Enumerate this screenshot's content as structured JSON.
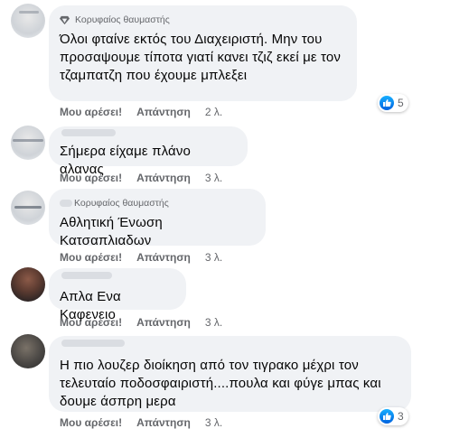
{
  "comments": [
    {
      "badge": "Κορυφαίος θαυμαστής",
      "lines": [
        "Όλοι φταίνε εκτός του Διαχειριστή. Μην του",
        "προσαψουμε τίποτα γιατί κανει τζιζ εκεί με τον",
        "τζαμπατζη που έχουμε μπλεξει"
      ],
      "like": "Μου αρέσει!",
      "reply": "Απάντηση",
      "time": "2 λ.",
      "reaction_count": "5"
    },
    {
      "badge": "",
      "lines": [
        "Σήμερα είχαμε πλάνο αλανας"
      ],
      "like": "Μου αρέσει!",
      "reply": "Απάντηση",
      "time": "3 λ."
    },
    {
      "badge": "Κορυφαίος θαυμαστής",
      "lines": [
        "Αθλητική Ένωση Κατσαπλιαδων"
      ],
      "like": "Μου αρέσει!",
      "reply": "Απάντηση",
      "time": "3 λ."
    },
    {
      "badge": "",
      "lines": [
        "Απλα Ενα Καφενειο"
      ],
      "like": "Μου αρέσει!",
      "reply": "Απάντηση",
      "time": "3 λ."
    },
    {
      "badge": "",
      "lines": [
        "Η πιο λουζερ διοίκηση από τον τιγρακο μέχρι τον",
        "τελευταίο ποδοσφαιριστή....πουλα και φύγε μπας και",
        "δουμε άσπρη μερα"
      ],
      "like": "Μου αρέσει!",
      "reply": "Απάντηση",
      "time": "3 λ.",
      "reaction_count": "3"
    }
  ],
  "colors": {
    "bubble": "#f0f2f5",
    "secondary_text": "#65676b",
    "like_blue": "#1877f2"
  },
  "icons": [
    "top-fan-diamond-icon",
    "like-thumb-icon"
  ]
}
